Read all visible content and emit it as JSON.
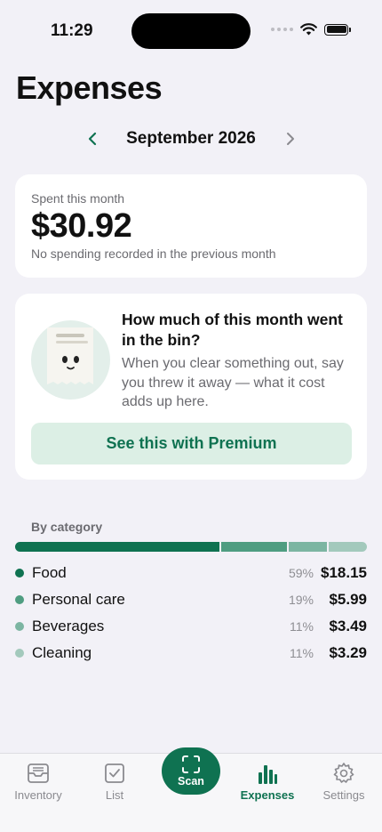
{
  "status": {
    "time": "11:29"
  },
  "title": "Expenses",
  "month": {
    "label": "September 2026"
  },
  "spent": {
    "label": "Spent this month",
    "amount": "$30.92",
    "note": "No spending recorded in the previous month"
  },
  "bin_card": {
    "title": "How much of this month went in the bin?",
    "body": "When you clear something out, say you threw it away — what it cost adds up here.",
    "button": "See this with Premium"
  },
  "categories": {
    "heading": "By category",
    "items": [
      {
        "name": "Food",
        "pct": "59%",
        "amount": "$18.15",
        "share": 0.59,
        "color": "#0f7251"
      },
      {
        "name": "Personal care",
        "pct": "19%",
        "amount": "$5.99",
        "share": 0.19,
        "color": "#4f9d81"
      },
      {
        "name": "Beverages",
        "pct": "11%",
        "amount": "$3.49",
        "share": 0.11,
        "color": "#7cb5a2"
      },
      {
        "name": "Cleaning",
        "pct": "11%",
        "amount": "$3.29",
        "share": 0.11,
        "color": "#a3c9bc"
      }
    ]
  },
  "tabs": {
    "inventory": "Inventory",
    "list": "List",
    "scan": "Scan",
    "expenses": "Expenses",
    "settings": "Settings"
  },
  "colors": {
    "accent": "#0f7251",
    "accent_light": "#dcefe5",
    "background": "#f2f1f7"
  }
}
